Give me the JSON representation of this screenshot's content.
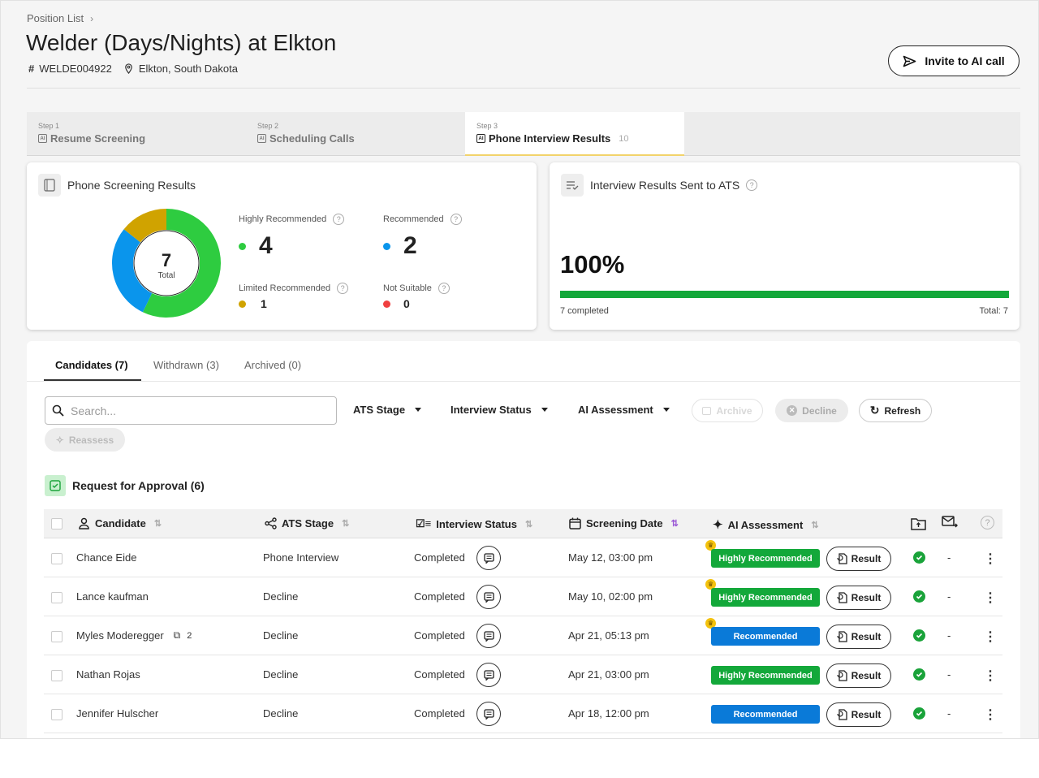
{
  "breadcrumb": {
    "label": "Position List"
  },
  "header": {
    "title": "Welder (Days/Nights) at Elkton",
    "code": "WELDE004922",
    "location": "Elkton, South Dakota",
    "invite_label": "Invite to AI call"
  },
  "steps": [
    {
      "step": "Step 1",
      "label": "Resume Screening",
      "count": ""
    },
    {
      "step": "Step 2",
      "label": "Scheduling Calls",
      "count": ""
    },
    {
      "step": "Step 3",
      "label": "Phone Interview Results",
      "count": "10"
    }
  ],
  "screening": {
    "title": "Phone Screening Results",
    "total": "7",
    "total_label": "Total",
    "highly_label": "Highly Recommended",
    "highly": "4",
    "rec_label": "Recommended",
    "rec": "2",
    "limited_label": "Limited Recommended",
    "limited": "1",
    "notsuit_label": "Not Suitable",
    "notsuit": "0",
    "colors": {
      "highly": "#2ecc40",
      "rec": "#0a95ec",
      "limited": "#d0a300",
      "notsuit": "#f04040"
    }
  },
  "ats": {
    "title": "Interview Results Sent to ATS",
    "percent": "100%",
    "progress": 1.0,
    "completed": "7 completed",
    "total": "Total: 7"
  },
  "tabs": [
    {
      "label": "Candidates (7)"
    },
    {
      "label": "Withdrawn (3)"
    },
    {
      "label": "Archived (0)"
    }
  ],
  "toolbar": {
    "search_placeholder": "Search...",
    "ats_stage": "ATS Stage",
    "interview_status": "Interview Status",
    "ai_assessment": "AI Assessment",
    "archive": "Archive",
    "decline": "Decline",
    "refresh": "Refresh",
    "reassess": "Reassess"
  },
  "approval": {
    "label": "Request for Approval (6)"
  },
  "columns": {
    "candidate": "Candidate",
    "ats_stage": "ATS Stage",
    "interview_status": "Interview Status",
    "screening_date": "Screening Date",
    "ai_assessment": "AI Assessment"
  },
  "rows": [
    {
      "name": "Chance Eide",
      "stage": "Phone Interview",
      "status": "Completed",
      "date": "May 12, 03:00 pm",
      "assessment": "Highly Recommended",
      "result": "Result",
      "sent": "-",
      "copies": ""
    },
    {
      "name": "Lance kaufman",
      "stage": "Decline",
      "status": "Completed",
      "date": "May 10, 02:00 pm",
      "assessment": "Highly Recommended",
      "result": "Result",
      "sent": "-",
      "copies": ""
    },
    {
      "name": "Myles Moderegger",
      "stage": "Decline",
      "status": "Completed",
      "date": "Apr 21, 05:13 pm",
      "assessment": "Recommended",
      "result": "Result",
      "sent": "-",
      "copies": "2"
    },
    {
      "name": "Nathan Rojas",
      "stage": "Decline",
      "status": "Completed",
      "date": "Apr 21, 03:00 pm",
      "assessment": "Highly Recommended",
      "result": "Result",
      "sent": "-",
      "copies": ""
    },
    {
      "name": "Jennifer Hulscher",
      "stage": "Decline",
      "status": "Completed",
      "date": "Apr 18, 12:00 pm",
      "assessment": "Recommended",
      "result": "Result",
      "sent": "-",
      "copies": ""
    }
  ]
}
